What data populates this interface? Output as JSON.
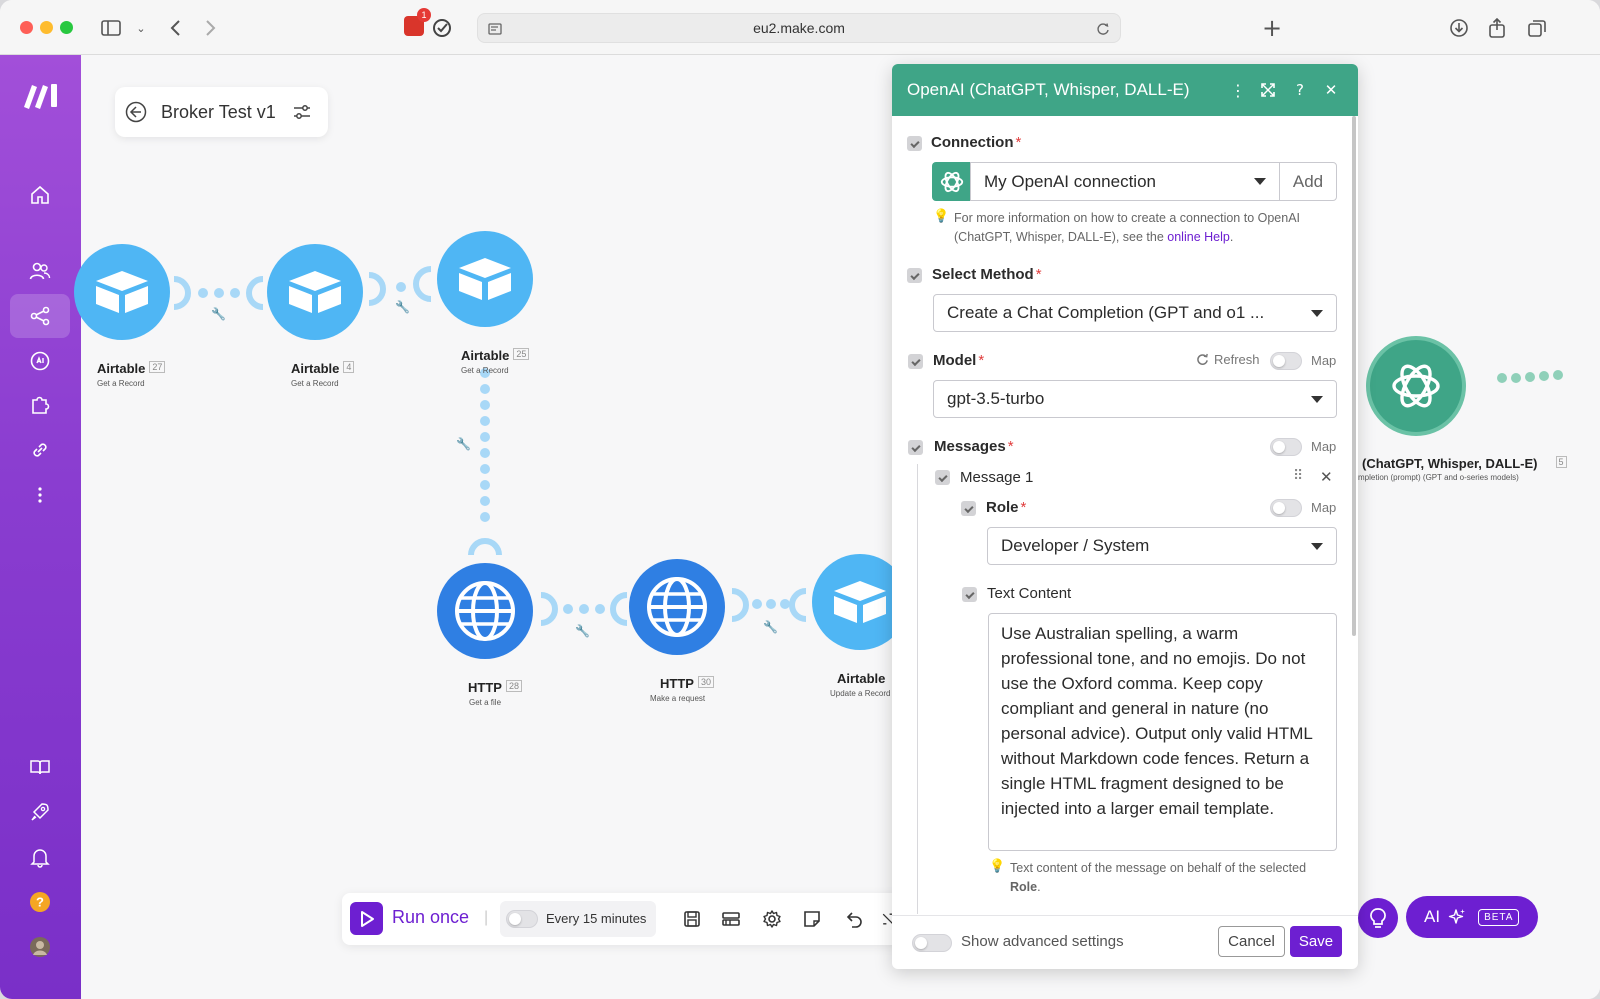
{
  "browser": {
    "url": "eu2.make.com",
    "extension_badge_count": "1"
  },
  "scenario": {
    "title": "Broker Test v1"
  },
  "nodes": [
    {
      "name": "Airtable",
      "num": "27",
      "sub": "Get a Record"
    },
    {
      "name": "Airtable",
      "num": "4",
      "sub": "Get a Record"
    },
    {
      "name": "Airtable",
      "num": "25",
      "sub": "Get a Record"
    },
    {
      "name": "HTTP",
      "num": "28",
      "sub": "Get a file"
    },
    {
      "name": "HTTP",
      "num": "30",
      "sub": "Make a request"
    },
    {
      "name": "Airtable",
      "num": "",
      "sub": "Update a Record"
    },
    {
      "name": "(ChatGPT, Whisper, DALL-E)",
      "num": "5",
      "sub": "mpletion (prompt) (GPT and o-series models)"
    }
  ],
  "toolbar": {
    "run_once": "Run once",
    "schedule": "Every 15 minutes"
  },
  "ai_button": {
    "label": "AI",
    "badge": "BETA"
  },
  "panel": {
    "title": "OpenAI (ChatGPT, Whisper, DALL-E)",
    "connection": {
      "label": "Connection",
      "value": "My OpenAI connection",
      "add_label": "Add",
      "hint_pre": "For more information on how to create a connection to OpenAI (ChatGPT, Whisper, DALL-E), see the ",
      "hint_link": "online Help",
      "hint_post": "."
    },
    "method": {
      "label": "Select Method",
      "value": "Create a Chat Completion (GPT and o1 ..."
    },
    "model": {
      "label": "Model",
      "refresh": "Refresh",
      "map": "Map",
      "value": "gpt-3.5-turbo"
    },
    "messages": {
      "label": "Messages",
      "map": "Map",
      "message_title": "Message 1",
      "role_label": "Role",
      "role_map": "Map",
      "role_value": "Developer / System",
      "text_label": "Text Content",
      "text_value": "Use Australian spelling, a warm professional tone, and no emojis. Do not use the Oxford comma. Keep copy compliant and general in nature (no personal advice). Output only valid HTML without Markdown code fences. Return a single HTML fragment designed to be injected into a larger email template.",
      "text_hint_pre": "Text content of the message on behalf of the selected ",
      "text_hint_bold": "Role",
      "text_hint_post": "."
    },
    "footer": {
      "advanced": "Show advanced settings",
      "cancel": "Cancel",
      "save": "Save"
    }
  },
  "colors": {
    "brand_purple": "#6d1fd1",
    "openai_green": "#3fa587",
    "airtable_blue": "#4fb6f4",
    "http_blue": "#2f7fe3",
    "required": "#e03c3c"
  }
}
